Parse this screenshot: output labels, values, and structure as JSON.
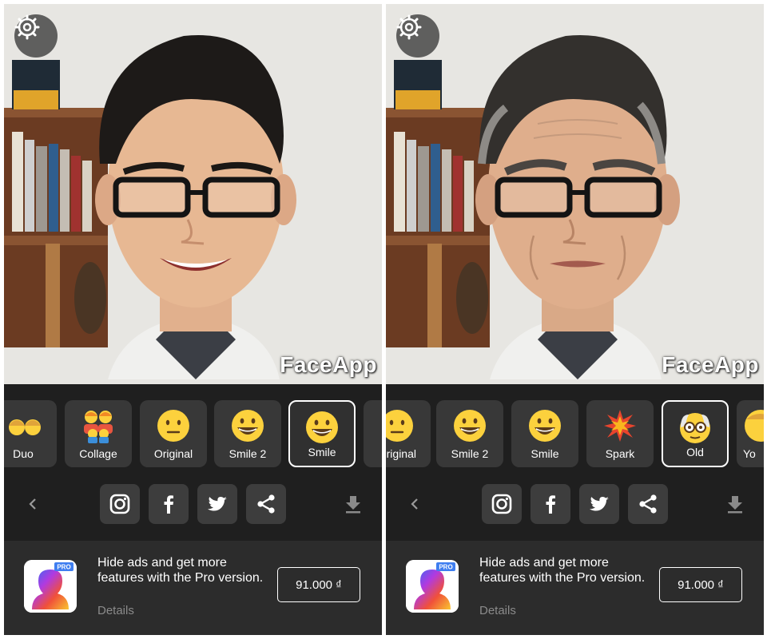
{
  "panels": [
    {
      "id": "before",
      "watermark": "FaceApp",
      "filters": [
        {
          "label": "Duo",
          "icon": "duo-emoji-icon",
          "selected": false
        },
        {
          "label": "Collage",
          "icon": "family-collage-icon",
          "selected": false
        },
        {
          "label": "Original",
          "icon": "neutral-face-icon",
          "selected": false
        },
        {
          "label": "Smile 2",
          "icon": "grin-face-icon",
          "selected": false
        },
        {
          "label": "Smile",
          "icon": "grin-face-icon",
          "selected": true
        }
      ],
      "ad": {
        "text": "Hide ads and get more features with the Pro version.",
        "details": "Details",
        "price": "91.000 ₫",
        "badge": "PRO"
      }
    },
    {
      "id": "after",
      "watermark": "FaceApp",
      "filters": [
        {
          "label": "riginal",
          "icon": "neutral-face-icon",
          "selected": false
        },
        {
          "label": "Smile 2",
          "icon": "grin-face-icon",
          "selected": false
        },
        {
          "label": "Smile",
          "icon": "grin-face-icon",
          "selected": false
        },
        {
          "label": "Spark",
          "icon": "spark-burst-icon",
          "selected": false
        },
        {
          "label": "Old",
          "icon": "old-man-icon",
          "selected": true
        },
        {
          "label": "Yo",
          "icon": "young-face-icon",
          "selected": false
        }
      ],
      "ad": {
        "text": "Hide ads and get more features with the Pro version.",
        "details": "Details",
        "price": "91.000 ₫",
        "badge": "PRO"
      }
    }
  ],
  "share_icons": [
    "instagram-icon",
    "facebook-icon",
    "twitter-icon",
    "share-icon"
  ],
  "colors": {
    "panel_bg": "#232323",
    "tile_bg": "#383838",
    "ad_bg": "#2c2c2c",
    "emoji_yellow": "#fcd13d"
  }
}
